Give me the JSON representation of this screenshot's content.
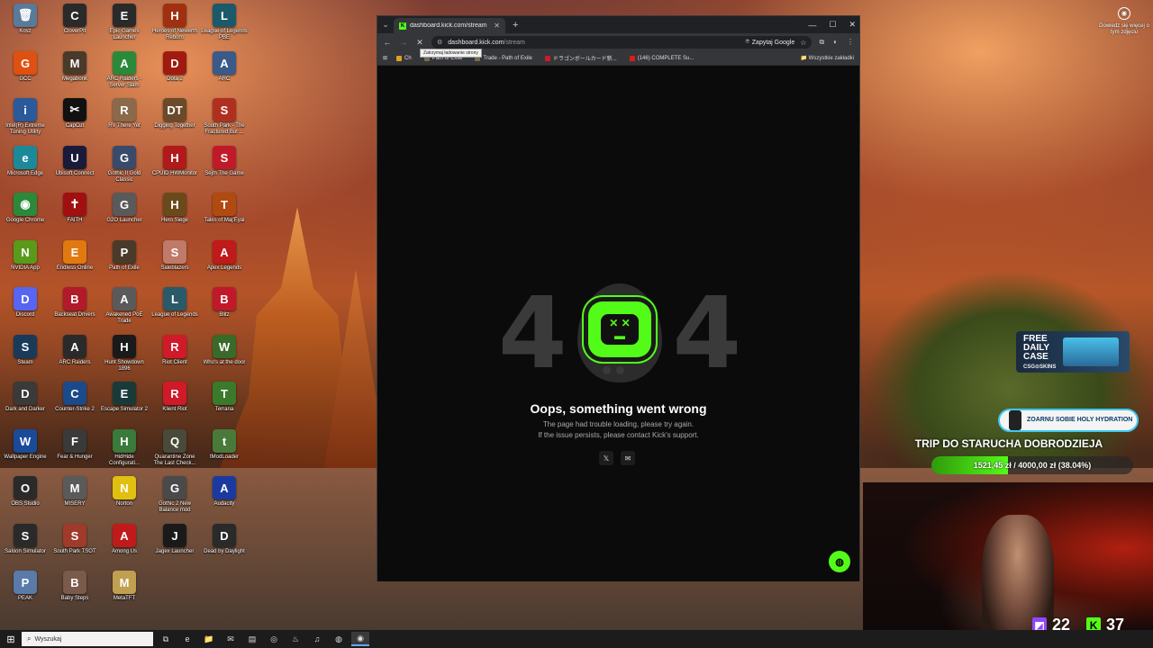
{
  "desktop": {
    "icons": [
      {
        "label": "Kosz",
        "glyph": "🗑",
        "color": "#5a7a9a"
      },
      {
        "label": "CloverPit",
        "glyph": "C",
        "color": "#2a2a2a"
      },
      {
        "label": "Epic Games Launcher",
        "glyph": "E",
        "color": "#2a2a2a"
      },
      {
        "label": "Heroes of Newerth Reborn",
        "glyph": "H",
        "color": "#a03010"
      },
      {
        "label": "League of Legends PBE",
        "glyph": "L",
        "color": "#1a5a6a"
      },
      {
        "label": "GCC",
        "glyph": "G",
        "color": "#e05010"
      },
      {
        "label": "Megabonk",
        "glyph": "M",
        "color": "#4a3a2a"
      },
      {
        "label": "ARC Raiders - Server Slam",
        "glyph": "A",
        "color": "#2a8a3a"
      },
      {
        "label": "Dota 2",
        "glyph": "D",
        "color": "#a01a10"
      },
      {
        "label": "ARC",
        "glyph": "A",
        "color": "#3a5a8a"
      },
      {
        "label": "Intel(R) Extreme Tuning Utility",
        "glyph": "i",
        "color": "#2a5a9a"
      },
      {
        "label": "CapCut",
        "glyph": "✂",
        "color": "#111111"
      },
      {
        "label": "RV There Yet",
        "glyph": "R",
        "color": "#8a6a4a"
      },
      {
        "label": "Digging Together",
        "glyph": "DT",
        "color": "#6a4a2a"
      },
      {
        "label": "South Park - The Fractured But ...",
        "glyph": "S",
        "color": "#b03020"
      },
      {
        "label": "Microsoft Edge",
        "glyph": "e",
        "color": "#1a8a9a"
      },
      {
        "label": "Ubisoft Connect",
        "glyph": "U",
        "color": "#1a1a3a"
      },
      {
        "label": "Gothic II Gold Classic",
        "glyph": "G",
        "color": "#3a4a6a"
      },
      {
        "label": "CPUID HWMonitor",
        "glyph": "H",
        "color": "#b01a1a"
      },
      {
        "label": "Sejm The Game",
        "glyph": "S",
        "color": "#c01a2a"
      },
      {
        "label": "Google Chrome",
        "glyph": "◉",
        "color": "#2a8a3a"
      },
      {
        "label": "FAITH",
        "glyph": "✝",
        "color": "#a01010"
      },
      {
        "label": "G2O Launcher",
        "glyph": "G",
        "color": "#5a5a5a"
      },
      {
        "label": "Hero Siege",
        "glyph": "H",
        "color": "#6a4a1a"
      },
      {
        "label": "Tales of Maj'Eyal",
        "glyph": "T",
        "color": "#b04a10"
      },
      {
        "label": "NVIDIA App",
        "glyph": "N",
        "color": "#5a9a1a"
      },
      {
        "label": "Endless Online",
        "glyph": "E",
        "color": "#e07a10"
      },
      {
        "label": "Path of Exile",
        "glyph": "P",
        "color": "#4a3a2a"
      },
      {
        "label": "Saleblazers",
        "glyph": "S",
        "color": "#c07a6a"
      },
      {
        "label": "Apex Legends",
        "glyph": "A",
        "color": "#c01a1a"
      },
      {
        "label": "Discord",
        "glyph": "D",
        "color": "#5865f2"
      },
      {
        "label": "Backseat Drivers",
        "glyph": "B",
        "color": "#b01a2a"
      },
      {
        "label": "Awakened PoE Trade",
        "glyph": "A",
        "color": "#5a5a5a"
      },
      {
        "label": "League of Legends",
        "glyph": "L",
        "color": "#2a5a6a"
      },
      {
        "label": "Blitz",
        "glyph": "B",
        "color": "#c01a2a"
      },
      {
        "label": "Steam",
        "glyph": "S",
        "color": "#1a3a5a"
      },
      {
        "label": "ARC Raiders",
        "glyph": "A",
        "color": "#2a2a2a"
      },
      {
        "label": "Hunt Showdown 1896",
        "glyph": "H",
        "color": "#1a1a1a"
      },
      {
        "label": "Riot Client",
        "glyph": "R",
        "color": "#d01a2a"
      },
      {
        "label": "Who's at the door",
        "glyph": "W",
        "color": "#3a6a2a"
      },
      {
        "label": "Dark and Darker",
        "glyph": "D",
        "color": "#3a3a3a"
      },
      {
        "label": "Counter-Strike 2",
        "glyph": "C",
        "color": "#1a4a8a"
      },
      {
        "label": "Escape Simulator 2",
        "glyph": "E",
        "color": "#1a3a3a"
      },
      {
        "label": "Klient Riot",
        "glyph": "R",
        "color": "#d01a2a"
      },
      {
        "label": "Terraria",
        "glyph": "T",
        "color": "#3a7a2a"
      },
      {
        "label": "Wallpaper Engine",
        "glyph": "W",
        "color": "#1a4a9a"
      },
      {
        "label": "Fear & Hunger",
        "glyph": "F",
        "color": "#3a3a3a"
      },
      {
        "label": "HidHide Configurati...",
        "glyph": "H",
        "color": "#3a7a3a"
      },
      {
        "label": "Quarantine Zone The Last Check...",
        "glyph": "Q",
        "color": "#4a4a3a"
      },
      {
        "label": "tModLoader",
        "glyph": "t",
        "color": "#4a7a3a"
      },
      {
        "label": "OBS Studio",
        "glyph": "O",
        "color": "#2a2a2a"
      },
      {
        "label": "MISERY",
        "glyph": "M",
        "color": "#5a5a5a"
      },
      {
        "label": "Norton",
        "glyph": "N",
        "color": "#e0c010"
      },
      {
        "label": "Gothic 2 New Balance mod",
        "glyph": "G",
        "color": "#4a4a4a"
      },
      {
        "label": "Audacity",
        "glyph": "A",
        "color": "#1a3aa0"
      },
      {
        "label": "Saloon Simulator",
        "glyph": "S",
        "color": "#2a2a2a"
      },
      {
        "label": "South Park TSOT",
        "glyph": "S",
        "color": "#a03a2a"
      },
      {
        "label": "Among Us",
        "glyph": "A",
        "color": "#c01a1a"
      },
      {
        "label": "Jagex Launcher",
        "glyph": "J",
        "color": "#1a1a1a"
      },
      {
        "label": "Dead by Daylight",
        "glyph": "D",
        "color": "#2a2a2a"
      },
      {
        "label": "PEAK",
        "glyph": "P",
        "color": "#5a7aaa"
      },
      {
        "label": "Baby Steps",
        "glyph": "B",
        "color": "#7a5a4a"
      },
      {
        "label": "MetaTFT",
        "glyph": "M",
        "color": "#c0a050"
      }
    ]
  },
  "browser": {
    "tab_title": "dashboard.kick.com/stream",
    "url_host": "dashboard.kick.com",
    "url_path": "/stream",
    "ask_google": "Zapytaj Google",
    "tooltip": "Zatrzymaj ładowanie strony",
    "bookmarks": [
      {
        "label": "Ch",
        "color": "#e0a020"
      },
      {
        "label": "Path of Exile",
        "color": "#7a6a4a"
      },
      {
        "label": "Trade - Path of Exile",
        "color": "#7a6a4a"
      },
      {
        "label": "ドラゴンボールカード新...",
        "color": "#d01a2a"
      },
      {
        "label": "(146) COMPLETE Su...",
        "color": "#e01a1a"
      }
    ],
    "all_bookmarks": "Wszystkie zakładki"
  },
  "error_page": {
    "digit_left": "4",
    "digit_right": "4",
    "robot_face": "x x\n▬",
    "title": "Oops, something went wrong",
    "line1": "The page had trouble loading, please try again.",
    "line2": "If the issue persists, please contact Kick's support.",
    "x_icon": "𝕏",
    "mail_icon": "✉",
    "accent": "#53fc18"
  },
  "overlay": {
    "learn_more": "Dowiedz się więcej o tym zdjęciu",
    "promo_line1": "FREE",
    "promo_line2": "DAILY",
    "promo_line3": "CASE",
    "promo_brand": "CSG⊙SKINS",
    "zoom_text": "ZOARNU SOBIE HOLY HYDRATION",
    "trip_title": "TRIP DO STARUCHA DOBRODZIEJA",
    "progress_text": "1521,45 zł / 4000,00 zł (38.04%)",
    "progress_fraction": 0.3804,
    "twitch_viewers": "22",
    "kick_viewers": "37",
    "twitch_color": "#9146ff",
    "kick_color": "#53fc18"
  },
  "taskbar": {
    "search_placeholder": "Wyszukaj"
  }
}
